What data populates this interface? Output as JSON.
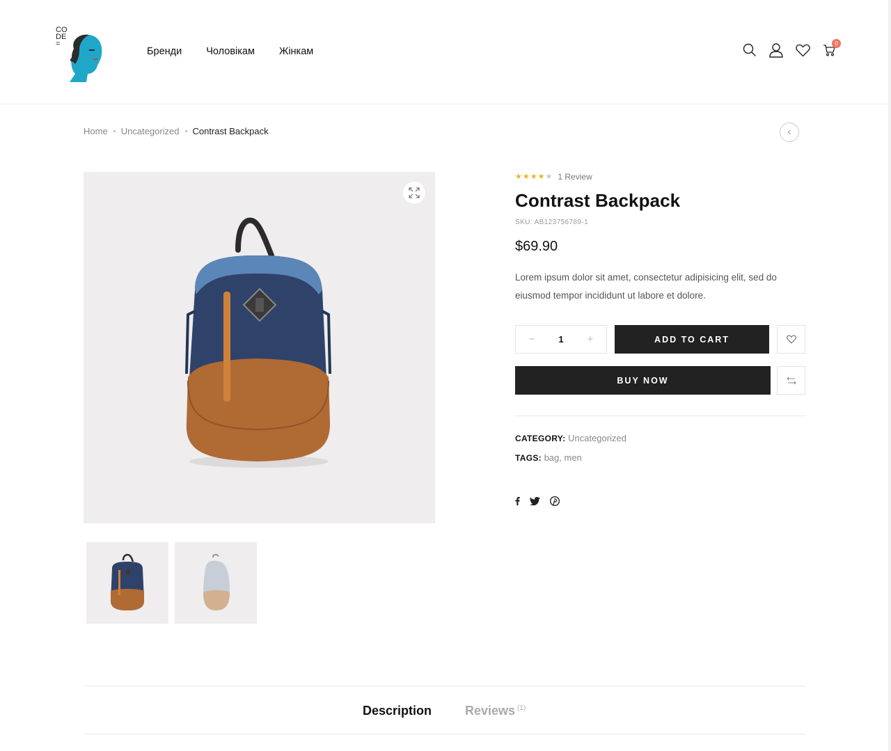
{
  "header": {
    "logo_lines": [
      "CO",
      "DE",
      "="
    ],
    "nav": [
      "Бренди",
      "Чоловікам",
      "Жінкам"
    ],
    "cart_count": "0"
  },
  "breadcrumb": {
    "home": "Home",
    "category": "Uncategorized",
    "current": "Contrast Backpack"
  },
  "product": {
    "rating": 4,
    "rating_max": 5,
    "review_count": "1 Review",
    "title": "Contrast Backpack",
    "sku": "SKU: AB123756789-1",
    "price": "$69.90",
    "short_description": "Lorem ipsum dolor sit amet, consectetur adipisicing elit, sed do eiusmod tempor incididunt ut labore et dolore.",
    "quantity": "1",
    "add_to_cart_label": "ADD TO CART",
    "buy_now_label": "BUY NOW",
    "category_label": "CATEGORY:",
    "category_value": "Uncategorized",
    "tags_label": "TAGS:",
    "tags_value": "bag, men"
  },
  "social": [
    "facebook-icon",
    "twitter-icon",
    "pinterest-icon"
  ],
  "tabs": {
    "description": "Description",
    "reviews": "Reviews",
    "reviews_count": "(1)"
  },
  "colors": {
    "accent_star": "#f0b21f",
    "button_dark": "#222222",
    "cart_badge": "#f2745f",
    "logo_face": "#1fa7c9"
  }
}
